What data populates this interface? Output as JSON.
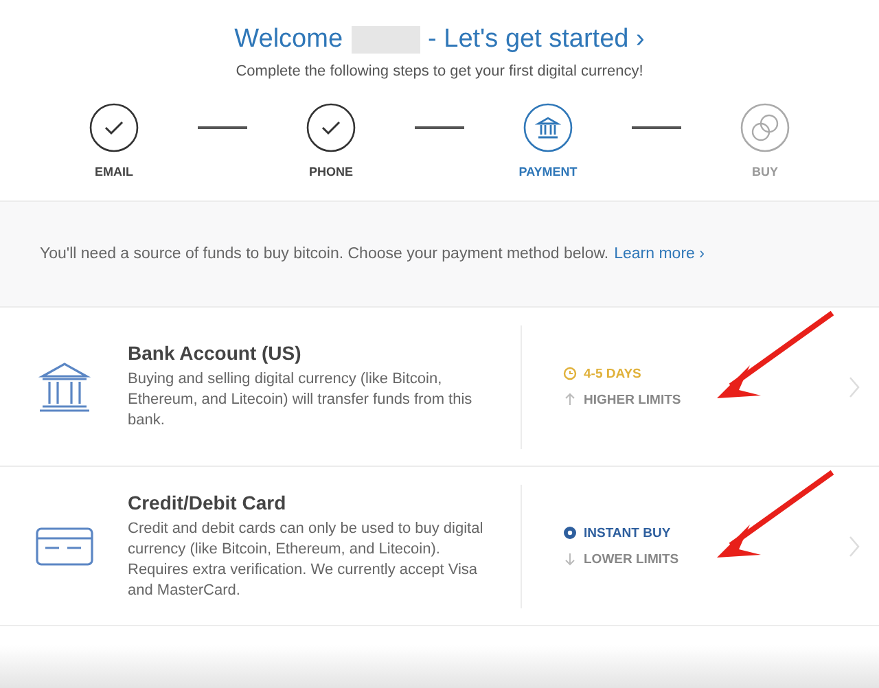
{
  "header": {
    "title_before": "Welcome",
    "name_redacted": true,
    "title_after": "- Let's get started ›",
    "subtitle": "Complete the following steps to get your first digital currency!"
  },
  "steps": [
    {
      "label": "EMAIL",
      "kind": "done",
      "selected": false
    },
    {
      "label": "PHONE",
      "kind": "done",
      "selected": false
    },
    {
      "label": "PAYMENT",
      "kind": "bank",
      "selected": true
    },
    {
      "label": "BUY",
      "kind": "coins",
      "selected": false
    }
  ],
  "notice": {
    "text": "You'll need a source of funds to buy bitcoin. Choose your payment method below.",
    "link": "Learn more ›"
  },
  "methods": [
    {
      "kind": "bank",
      "title": "Bank Account (US)",
      "description": "Buying and selling digital currency (like Bitcoin, Ethereum, and Litecoin) will transfer funds from this bank.",
      "features": [
        {
          "kind": "slow",
          "text": "4-5 DAYS"
        },
        {
          "kind": "up",
          "text": "HIGHER LIMITS"
        }
      ],
      "annotated": true
    },
    {
      "kind": "card",
      "title": "Credit/Debit Card",
      "description": "Credit and debit cards can only be used to buy digital currency (like Bitcoin, Ethereum, and Litecoin). Requires extra verification. We currently accept Visa and MasterCard.",
      "features": [
        {
          "kind": "instant",
          "text": "INSTANT BUY"
        },
        {
          "kind": "down",
          "text": "LOWER LIMITS"
        }
      ],
      "annotated": true
    }
  ]
}
